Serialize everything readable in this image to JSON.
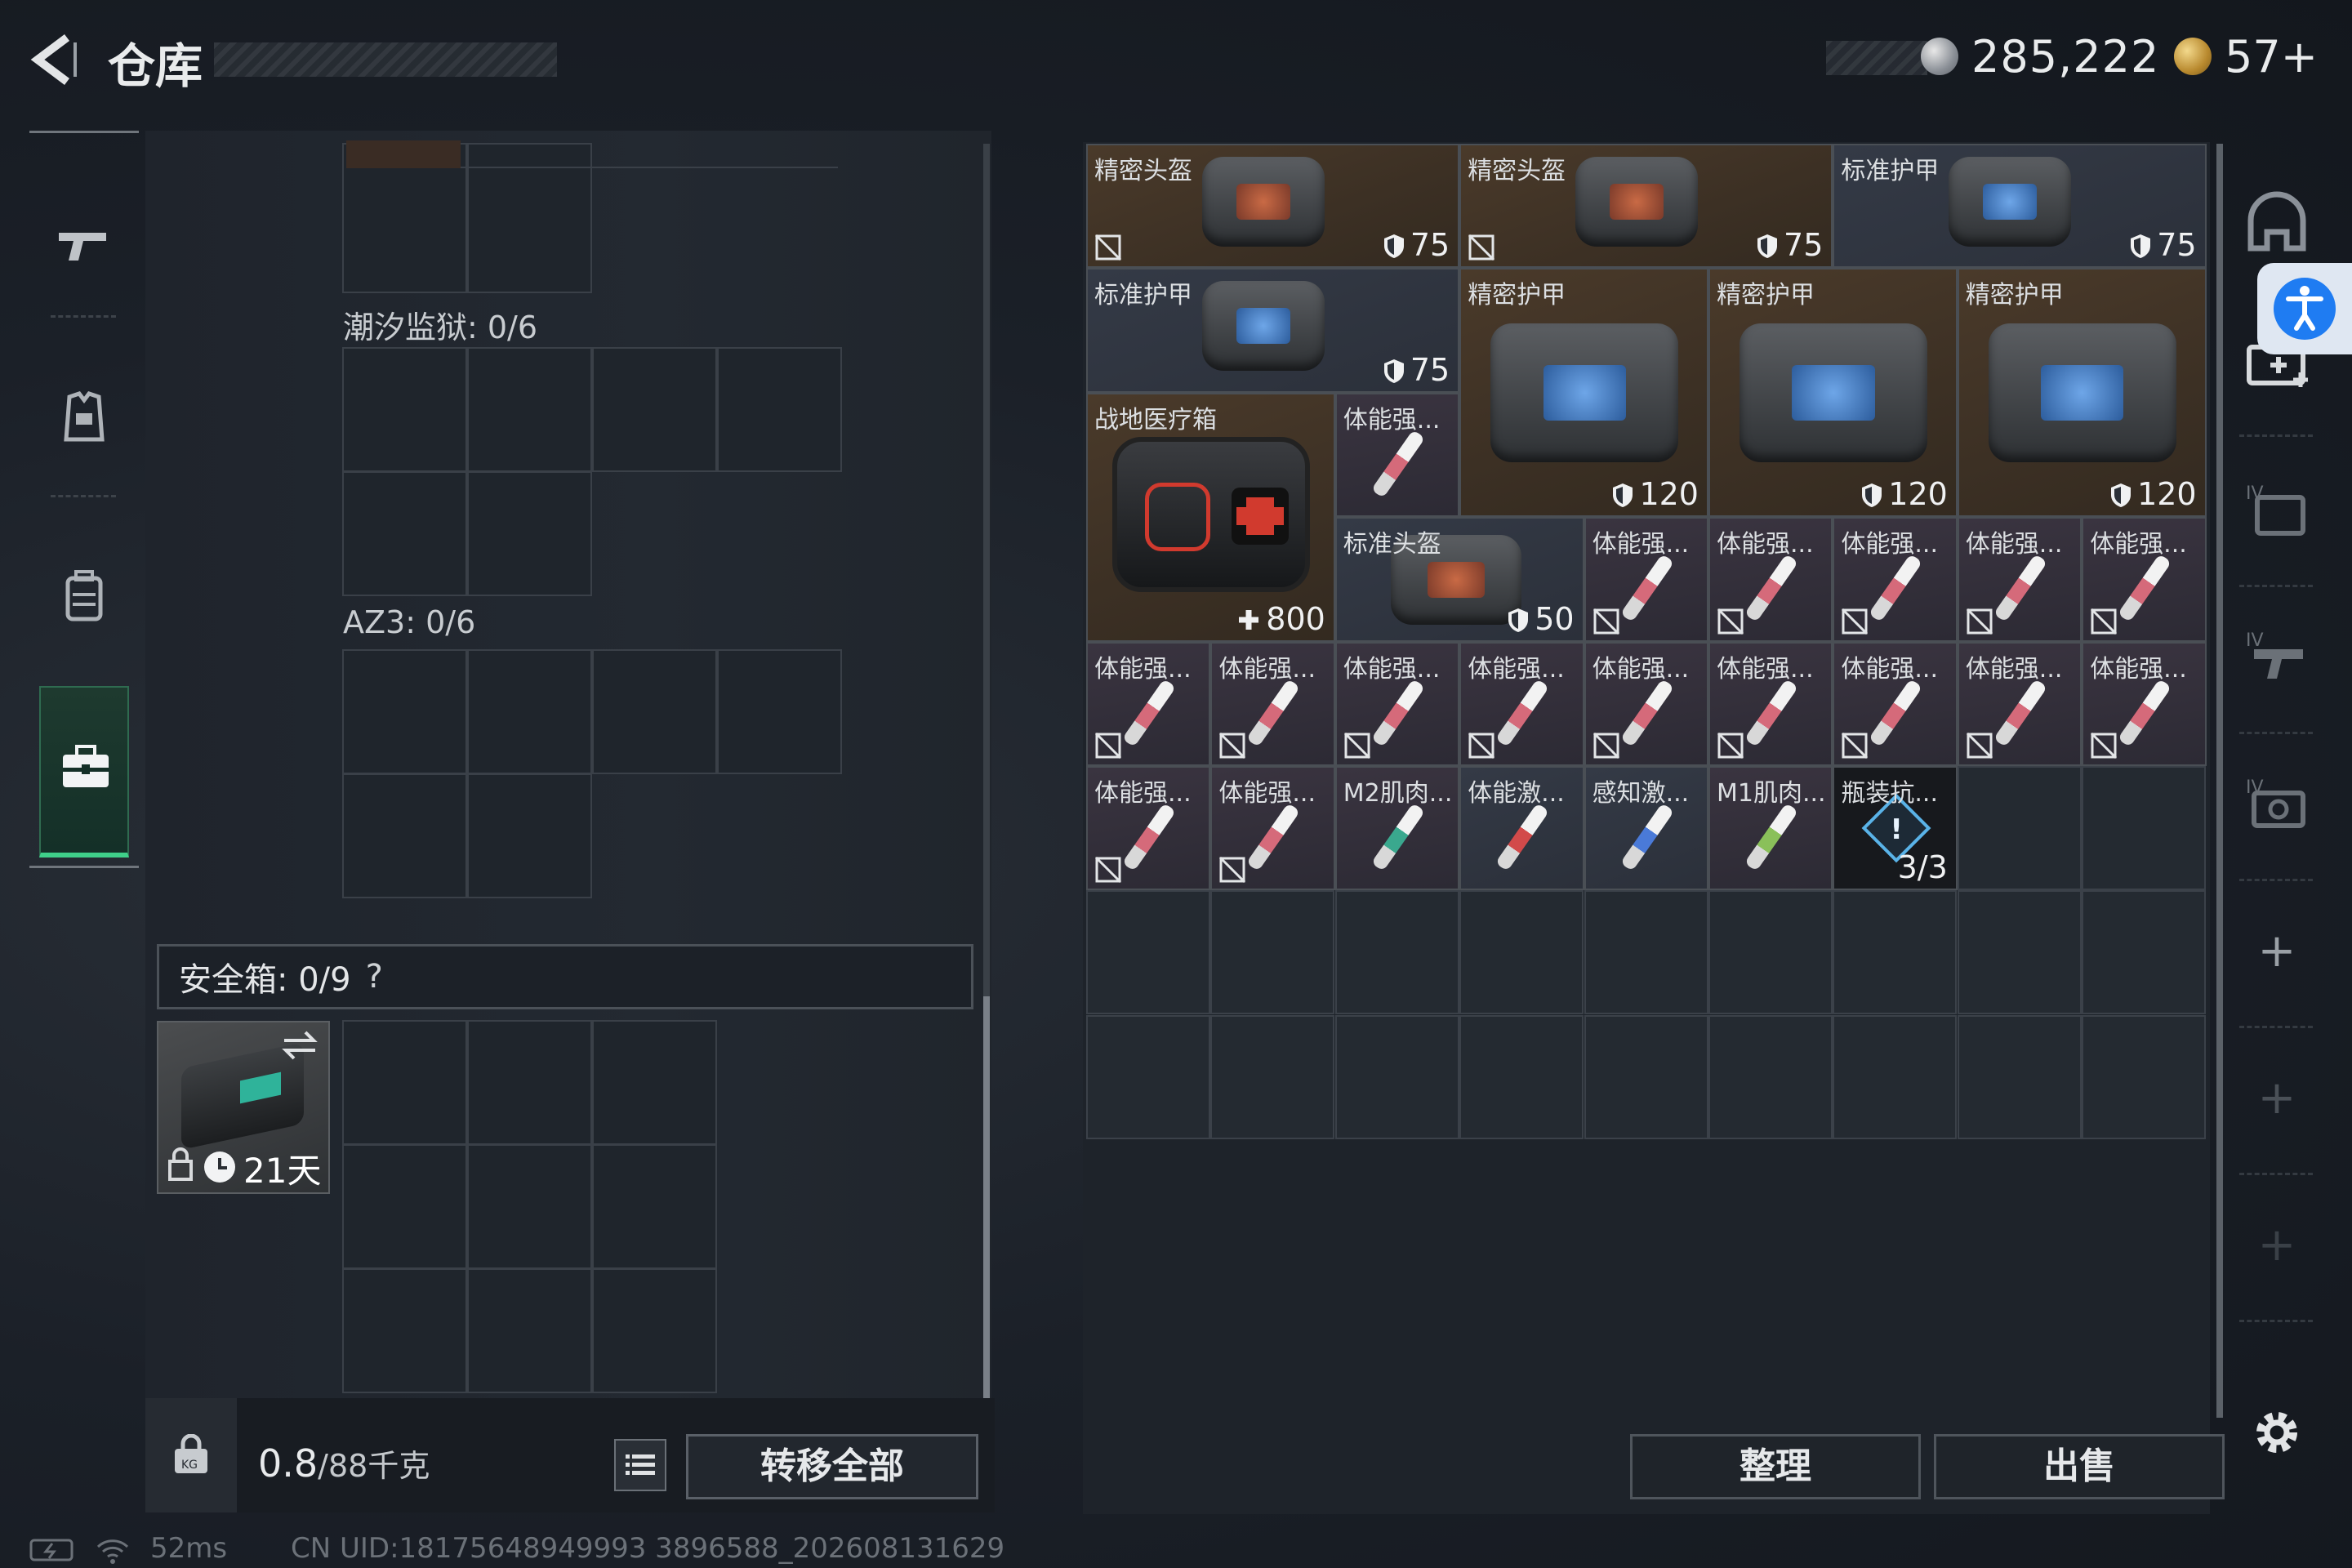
{
  "header": {
    "title": "仓库",
    "silver_amount": "285,222",
    "gold_amount": "57+"
  },
  "left_panel": {
    "section_tide": "潮汐监狱: 0/6",
    "section_az3": "AZ3: 0/6",
    "safebox": {
      "label": "安全箱: 0/9",
      "help": "?",
      "item_days": "21天"
    },
    "weight": {
      "current": "0.8",
      "capacity": "/88千克"
    },
    "transfer_all": "转移全部"
  },
  "inventory": {
    "items": [
      {
        "name": "精密头盔",
        "value": "75",
        "kind": "helmet"
      },
      {
        "name": "精密头盔",
        "value": "75",
        "kind": "helmet"
      },
      {
        "name": "标准护甲",
        "value": "75",
        "kind": "armor"
      },
      {
        "name": "标准护甲",
        "value": "75",
        "kind": "armor"
      },
      {
        "name": "精密护甲",
        "value": "120",
        "kind": "armor"
      },
      {
        "name": "精密护甲",
        "value": "120",
        "kind": "armor"
      },
      {
        "name": "精密护甲",
        "value": "120",
        "kind": "armor"
      },
      {
        "name": "战地医疗箱",
        "value": "800",
        "kind": "medkit"
      },
      {
        "name": "体能强...",
        "kind": "syringe"
      },
      {
        "name": "标准头盔",
        "value": "50",
        "kind": "helmet"
      },
      {
        "name": "瓶装抗...",
        "value": "3/3",
        "kind": "bottle"
      }
    ],
    "syringe_label": "体能强...",
    "m2": "M2肌肉...",
    "tineng_ji": "体能激...",
    "ganzhi": "感知激...",
    "m1": "M1肌肉..."
  },
  "buttons": {
    "sort": "整理",
    "sell": "出售"
  },
  "status": {
    "ping": "52ms",
    "uid": "CN UID:18175648949993 3896588_202608131629"
  },
  "colors": {
    "accent": "#3fd08a",
    "brown_item": "#4a3a2a",
    "blue_item": "#343a46"
  }
}
